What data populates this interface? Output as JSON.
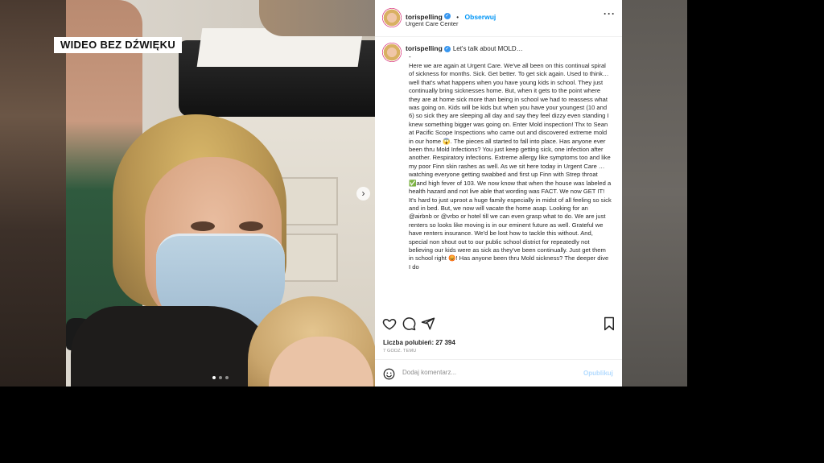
{
  "overlay": {
    "badge": "WIDEO BEZ DŹWIĘKU"
  },
  "carousel": {
    "next_icon": "chevron-right-icon",
    "slide_count": 3,
    "active_slide": 1
  },
  "post": {
    "username": "torispelling",
    "follow_label": "Obserwuj",
    "location": "Urgent Care Center",
    "more_icon": "more-horizontal-icon",
    "caption_head": "Let's talk about MOLD…",
    "caption_dash": "-",
    "caption_body": "Here we are again at Urgent Care. We've all been on this continual spiral of sickness for months. Sick. Get better. To get sick again. Used to think… well that's what happens when you have young kids in school. They just continually bring sicknesses home. But, when it gets to the point where they are at home sick more than being in school we had to reassess what was going on. Kids will be kids but when you have your youngest (10 and 6) so sick they are sleeping all day and say they feel dizzy even standing I knew something bigger was going on. Enter Mold inspection! Thx to Sean at Pacific Scope Inspections who came out and discovered extreme mold in our home 😱. The pieces all started to fall into place. Has anyone ever been thru Mold Infections? You just keep getting sick, one infection after another. Respiratory infections. Extreme allergy like symptoms too and like my poor Finn skin rashes as well. As we sit here today in Urgent Care … watching everyone getting swabbed and first up Finn with Strep throat ✅and high fever of 103. We now know that when the house was labeled a health hazard and not live able that wording was FACT. We now GET IT! It's hard to just uproot a huge family especially in midst of all feeling so sick and in bed. But, we now will vacate the home asap. Looking for an @airbnb or @vrbo or hotel till we can even grasp what to do. We are just renters so looks like moving is in our eminent future as well. Grateful we have renters insurance. We'd be lost how to tackle this without. And, special non shout out to our public school district for repeatedly not believing our kids were as sick as they've been continually. Just get them in school right 😡! Has anyone been thru Mold sickness? The deeper dive I do",
    "likes_label": "Liczba polubień: 27 394",
    "time_ago": "7 GODZ. TEMU",
    "comment_placeholder": "Dodaj komentarz...",
    "post_label": "Opublikuj",
    "icons": [
      "heart-icon",
      "comment-icon",
      "share-icon",
      "bookmark-icon",
      "emoji-icon",
      "verified-icon"
    ],
    "colors": {
      "link": "#0095f6",
      "verified": "#3897f0",
      "post_disabled": "#b3dbff"
    }
  }
}
